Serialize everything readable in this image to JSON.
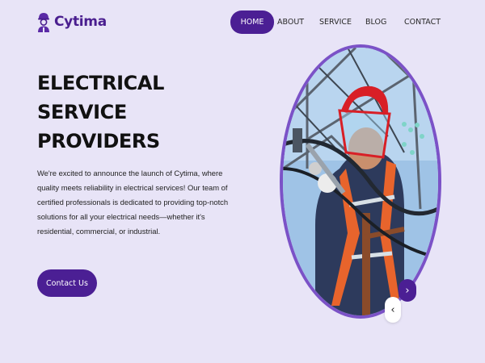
{
  "brand": {
    "name": "Cytima",
    "color": "#4a1e8f",
    "icon": "worker-logo-icon"
  },
  "nav": {
    "items": [
      {
        "label": "HOME",
        "active": true
      },
      {
        "label": "ABOUT",
        "active": false
      },
      {
        "label": "SERVICE",
        "active": false
      },
      {
        "label": "BLOG",
        "active": false
      },
      {
        "label": "CONTACT",
        "active": false
      }
    ],
    "active_color": "#4b1f94"
  },
  "hero": {
    "title_lines": [
      "ELECTRICAL",
      "SERVICE",
      "PROVIDERS"
    ],
    "description": "We're excited to announce the launch of Cytima, where quality meets reliability in electrical services! Our team of certified professionals is dedicated to providing top-notch solutions for all your electrical needs—whether it's residential, commercial, or industrial.",
    "cta_label": "Contact Us",
    "image_icon": "electrician-photo",
    "image_border_color": "#7b52c7"
  },
  "slider": {
    "next_symbol": "›",
    "prev_symbol": "‹",
    "next_icon": "chevron-right-icon",
    "prev_icon": "chevron-left-icon"
  },
  "colors": {
    "background": "#e8e4f7",
    "accent": "#4b1f94"
  }
}
